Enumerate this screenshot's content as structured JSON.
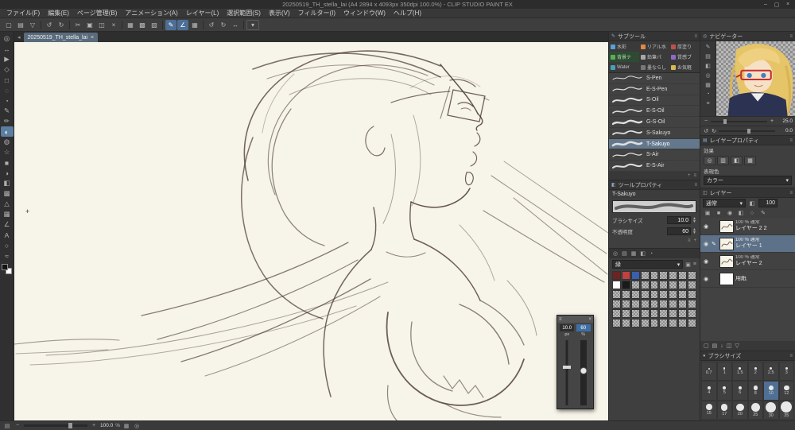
{
  "titlebar": {
    "title": "20250519_TH_stella_lai (A4 2894 x 4093px 350dpi 100.0%) - CLIP STUDIO PAINT EX",
    "buttons": [
      {
        "name": "minimize-button",
        "glyph": "–"
      },
      {
        "name": "maximize-button",
        "glyph": "▢"
      },
      {
        "name": "close-button",
        "glyph": "×"
      }
    ]
  },
  "menubar": {
    "items": [
      "ファイル(F)",
      "編集(E)",
      "ページ管理(B)",
      "アニメーション(A)",
      "レイヤー(L)",
      "選択範囲(S)",
      "表示(V)",
      "フィルター(I)",
      "ウィンドウ(W)",
      "ヘルプ(H)"
    ]
  },
  "toolbar": {
    "icons": [
      {
        "name": "new-file-icon",
        "glyph": "▢"
      },
      {
        "name": "open-file-icon",
        "glyph": "▤"
      },
      {
        "name": "save-icon",
        "glyph": "▽"
      },
      {
        "name": "separator"
      },
      {
        "name": "undo-icon",
        "glyph": "↺"
      },
      {
        "name": "redo-icon",
        "glyph": "↻"
      },
      {
        "name": "separator"
      },
      {
        "name": "cut-icon",
        "glyph": "✂"
      },
      {
        "name": "copy-icon",
        "glyph": "▣"
      },
      {
        "name": "paste-icon",
        "glyph": "◫"
      },
      {
        "name": "delete-icon",
        "glyph": "×"
      },
      {
        "name": "separator"
      },
      {
        "name": "deselect-icon",
        "glyph": "▦"
      },
      {
        "name": "invert-selection-icon",
        "glyph": "▩"
      },
      {
        "name": "select-border-icon",
        "glyph": "▧"
      },
      {
        "name": "separator"
      },
      {
        "name": "snap-pen-icon",
        "glyph": "✎",
        "on": true
      },
      {
        "name": "snap-ruler-icon",
        "glyph": "∠",
        "on": true
      },
      {
        "name": "snap-grid-icon",
        "glyph": "▦"
      },
      {
        "name": "separator"
      },
      {
        "name": "rotate-left-icon",
        "glyph": "↺"
      },
      {
        "name": "rotate-right-icon",
        "glyph": "↻"
      },
      {
        "name": "flip-horizontal-icon",
        "glyph": "↔"
      },
      {
        "name": "separator"
      },
      {
        "name": "tool-options-dropdown",
        "glyph": "▾",
        "boxed": true
      }
    ]
  },
  "toolstrip": {
    "tools": [
      {
        "name": "zoom-tool",
        "glyph": "◎"
      },
      {
        "name": "move-tool",
        "glyph": "↔"
      },
      {
        "name": "operation-tool",
        "glyph": "▶"
      },
      {
        "name": "layer-move-tool",
        "glyph": "◇"
      },
      {
        "name": "selection-tool",
        "glyph": "□"
      },
      {
        "name": "auto-select-tool",
        "glyph": "◌"
      },
      {
        "name": "eyedropper-tool",
        "glyph": "◔"
      },
      {
        "name": "pen-tool",
        "glyph": "✎"
      },
      {
        "name": "pencil-tool",
        "glyph": "✏"
      },
      {
        "name": "brush-tool",
        "glyph": "◐",
        "selected": true
      },
      {
        "name": "airbrush-tool",
        "glyph": "◍"
      },
      {
        "name": "decoration-tool",
        "glyph": "☆"
      },
      {
        "name": "eraser-tool",
        "glyph": "■"
      },
      {
        "name": "blend-tool",
        "glyph": "◑"
      },
      {
        "name": "fill-tool",
        "glyph": "◧"
      },
      {
        "name": "gradient-tool",
        "glyph": "▩"
      },
      {
        "name": "figure-tool",
        "glyph": "△"
      },
      {
        "name": "frame-border-tool",
        "glyph": "▦"
      },
      {
        "name": "ruler-tool",
        "glyph": "∠"
      },
      {
        "name": "text-tool",
        "glyph": "A"
      },
      {
        "name": "balloon-tool",
        "glyph": "○"
      },
      {
        "name": "line-correction-tool",
        "glyph": "≈"
      }
    ],
    "fg_color": "#141414",
    "bg_color": "#ffffff"
  },
  "tabbar": {
    "scroll_glyph": "◂",
    "doc_tab": "20250519_TH_stella_lai",
    "close_label": "×"
  },
  "subtool": {
    "panel_title": "サブツール",
    "header_icon": "✎",
    "header_menu": "≡",
    "groups": [
      {
        "label": "水彩",
        "color": "#58a0dc"
      },
      {
        "label": "リアル水",
        "color": "#e08848"
      },
      {
        "label": "厚塗り",
        "color": "#c05050"
      },
      {
        "label": "背景テ",
        "color": "#58b058",
        "selected": true
      },
      {
        "label": "鉛筆パ",
        "color": "#a8a8a8"
      },
      {
        "label": "質感ブ",
        "color": "#9068c8"
      },
      {
        "label": "Water",
        "color": "#48a0b8"
      },
      {
        "label": "墨ならし",
        "color": "#787878"
      },
      {
        "label": "お気軽",
        "color": "#d8b850"
      }
    ],
    "brushes": [
      {
        "label": "S-Pen",
        "stroke_width": 1
      },
      {
        "label": "E-S-Pen",
        "stroke_width": 1.2
      },
      {
        "label": "S-Oil",
        "stroke_width": 2
      },
      {
        "label": "E-S-Oil",
        "stroke_width": 1.6
      },
      {
        "label": "G-S-Oil",
        "stroke_width": 2.4
      },
      {
        "label": "S-Sakuyo",
        "stroke_width": 1.8
      },
      {
        "label": "T-Sakuyo",
        "stroke_width": 2.6,
        "selected": true
      },
      {
        "label": "S-Air",
        "stroke_width": 1.2
      },
      {
        "label": "E-S-Air",
        "stroke_width": 2
      }
    ],
    "footer_icons": [
      {
        "name": "add-subtool-icon",
        "glyph": "+"
      },
      {
        "name": "subtool-menu-icon",
        "glyph": "≡"
      }
    ]
  },
  "tool_property": {
    "panel_title": "ツールプロパティ",
    "header_icon": "◧",
    "header_menu": "≡",
    "tool_name": "T-Sakuyo",
    "brush_size_label": "ブラシサイズ",
    "brush_size_value": "10.0",
    "opacity_label": "不透明度",
    "opacity_value": "60",
    "footer_icons": [
      {
        "name": "property-detail-icon",
        "glyph": "≡"
      },
      {
        "name": "register-initial-icon",
        "glyph": "+"
      }
    ]
  },
  "color_panel": {
    "tabs": [
      {
        "name": "color-wheel-icon",
        "glyph": "◎"
      },
      {
        "name": "color-slider-icon",
        "glyph": "▤"
      },
      {
        "name": "color-set-icon",
        "glyph": "▦"
      },
      {
        "name": "intermediate-color-icon",
        "glyph": "◧"
      },
      {
        "name": "color-history-icon",
        "glyph": "◔"
      }
    ],
    "set_name": "縁",
    "set_caret": "▾",
    "lock_glyph": "▣",
    "menu_glyph": "≡",
    "chip_count": 54,
    "chips_colored": {
      "0": "#6e2222",
      "1": "#c24040",
      "2": "#3a5fae",
      "9": "#ffffff",
      "10": "#1a1a1a"
    }
  },
  "navigator": {
    "panel_title": "ナビゲーター",
    "header_icon": "◎",
    "header_menu": "≡",
    "side_icons": [
      {
        "name": "pen-settings-icon",
        "glyph": "✎"
      },
      {
        "name": "panel-list-icon",
        "glyph": "▤"
      },
      {
        "name": "fill-icon",
        "glyph": "◧"
      },
      {
        "name": "circle-icon",
        "glyph": "◎"
      },
      {
        "name": "grid-icon",
        "glyph": "▦"
      },
      {
        "name": "history-icon",
        "glyph": "◔"
      },
      {
        "name": "menu-icon",
        "glyph": "≡"
      }
    ],
    "zoom_out_glyph": "−",
    "zoom_in_glyph": "+",
    "zoom_value": "25.0",
    "rotate_left_glyph": "↺",
    "rotate_right_glyph": "↻",
    "rotation_value": "0.0"
  },
  "layer_property": {
    "panel_title": "レイヤープロパティ",
    "header_icon": "▤",
    "header_menu": "≡",
    "effect_label": "効果",
    "effect_icons": [
      {
        "name": "border-effect-icon",
        "glyph": "◎"
      },
      {
        "name": "tone-effect-icon",
        "glyph": "▥"
      },
      {
        "name": "extract-line-icon",
        "glyph": "◧"
      },
      {
        "name": "layer-color-icon",
        "glyph": "▦"
      }
    ],
    "expression_label": "表現色",
    "expression_value": "カラー",
    "expression_caret": "▾"
  },
  "layers": {
    "panel_title": "レイヤー",
    "header_icon": "◫",
    "header_menu": "≡",
    "blend_mode": "通常",
    "blend_caret": "▾",
    "opacity_value": "100",
    "opacity_icon": "◧",
    "lock_icons": [
      {
        "name": "transparency-lock-icon",
        "glyph": "▣"
      },
      {
        "name": "lock-icon",
        "glyph": "■"
      },
      {
        "name": "pin-icon",
        "glyph": "◉"
      },
      {
        "name": "clip-icon",
        "glyph": "◧"
      },
      {
        "name": "reference-icon",
        "glyph": "○"
      },
      {
        "name": "draft-icon",
        "glyph": "✎"
      }
    ],
    "eye_glyph": "◉",
    "edit_glyph": "✎",
    "items": [
      {
        "meta": "100 % 通常",
        "name": "レイヤー 2 2",
        "selected": false,
        "editing": false,
        "paper": false
      },
      {
        "meta": "100 % 通常",
        "name": "レイヤー 1",
        "selected": true,
        "editing": true,
        "paper": false
      },
      {
        "meta": "100 % 通常",
        "name": "レイヤー 2",
        "selected": false,
        "editing": false,
        "paper": false
      },
      {
        "meta": "",
        "name": "用紙",
        "selected": false,
        "editing": false,
        "paper": true
      }
    ],
    "footer_icons": [
      {
        "name": "new-layer-icon",
        "glyph": "▢"
      },
      {
        "name": "new-folder-icon",
        "glyph": "▤"
      },
      {
        "name": "merge-down-icon",
        "glyph": "↓"
      },
      {
        "name": "apply-mask-icon",
        "glyph": "◫"
      },
      {
        "name": "delete-layer-icon",
        "glyph": "▽"
      }
    ]
  },
  "brush_sizes": {
    "panel_title": "ブラシサイズ",
    "header_icon": "●",
    "header_menu": "≡",
    "sizes": [
      "0.7",
      "1",
      "1.5",
      "2",
      "2.5",
      "3",
      "4",
      "5",
      "6",
      "8",
      "10",
      "12",
      "15",
      "17",
      "20",
      "25",
      "30",
      "35"
    ],
    "selected": "10"
  },
  "floating_slider": {
    "drag_glyph": "≡",
    "close_label": "×",
    "size_value": "10.0",
    "size_unit": "px",
    "opacity_value": "60",
    "opacity_unit": "%"
  },
  "statusbar": {
    "memory_glyph": "▤",
    "zoom_out_glyph": "−",
    "zoom_in_glyph": "+",
    "zoom_value": "100.0",
    "zoom_unit": "%",
    "fit_glyph": "▦",
    "reset_glyph": "◎"
  }
}
